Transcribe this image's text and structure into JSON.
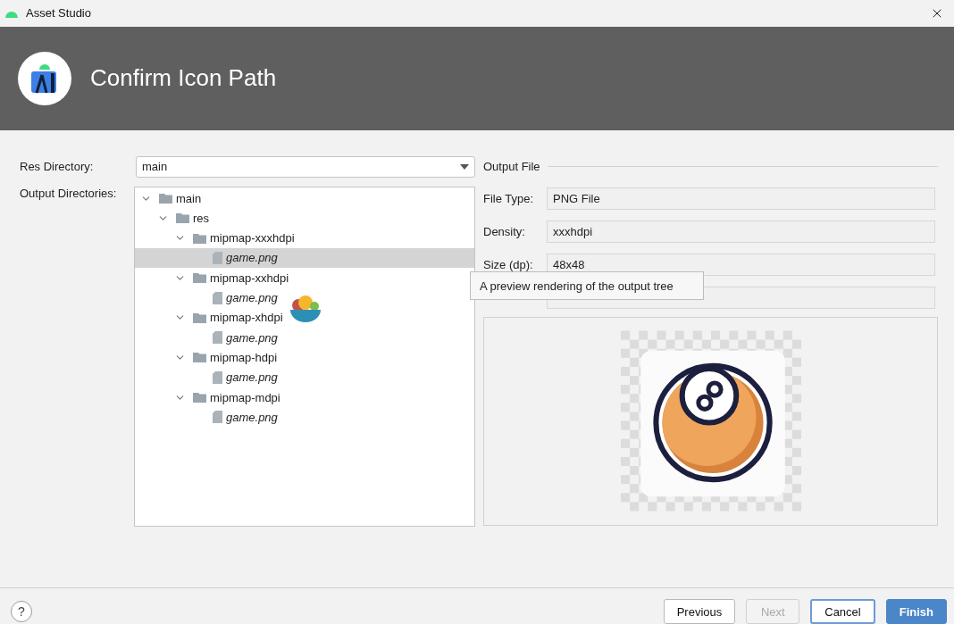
{
  "window": {
    "title": "Asset Studio"
  },
  "header": {
    "title": "Confirm Icon Path"
  },
  "res_directory": {
    "label": "Res Directory:",
    "value": "main"
  },
  "output_directories": {
    "label": "Output Directories:",
    "tree": [
      {
        "label": "main",
        "kind": "folder",
        "expanded": true,
        "selected": false,
        "children": [
          {
            "label": "res",
            "kind": "folder",
            "expanded": true,
            "selected": false,
            "children": [
              {
                "label": "mipmap-xxxhdpi",
                "kind": "folder",
                "expanded": true,
                "selected": false,
                "children": [
                  {
                    "label": "game.png",
                    "kind": "file",
                    "selected": true
                  }
                ]
              },
              {
                "label": "mipmap-xxhdpi",
                "kind": "folder",
                "expanded": true,
                "selected": false,
                "children": [
                  {
                    "label": "game.png",
                    "kind": "file",
                    "selected": false
                  }
                ]
              },
              {
                "label": "mipmap-xhdpi",
                "kind": "folder",
                "expanded": true,
                "selected": false,
                "children": [
                  {
                    "label": "game.png",
                    "kind": "file",
                    "selected": false
                  }
                ]
              },
              {
                "label": "mipmap-hdpi",
                "kind": "folder",
                "expanded": true,
                "selected": false,
                "children": [
                  {
                    "label": "game.png",
                    "kind": "file",
                    "selected": false
                  }
                ]
              },
              {
                "label": "mipmap-mdpi",
                "kind": "folder",
                "expanded": true,
                "selected": false,
                "children": [
                  {
                    "label": "game.png",
                    "kind": "file",
                    "selected": false
                  }
                ]
              }
            ]
          }
        ]
      }
    ]
  },
  "output_file": {
    "title": "Output File",
    "fields": [
      {
        "label": "File Type:",
        "value": "PNG File"
      },
      {
        "label": "Density:",
        "value": "xxxhdpi"
      },
      {
        "label": "Size (dp):",
        "value": "48x48"
      }
    ]
  },
  "tooltip": {
    "text": "A preview rendering of the output tree"
  },
  "help": "?",
  "buttons": [
    {
      "label": "Previous",
      "kind": "default",
      "disabled": false
    },
    {
      "label": "Next",
      "kind": "default",
      "disabled": true
    },
    {
      "label": "Cancel",
      "kind": "focused",
      "disabled": false
    },
    {
      "label": "Finish",
      "kind": "primary",
      "disabled": false
    }
  ]
}
